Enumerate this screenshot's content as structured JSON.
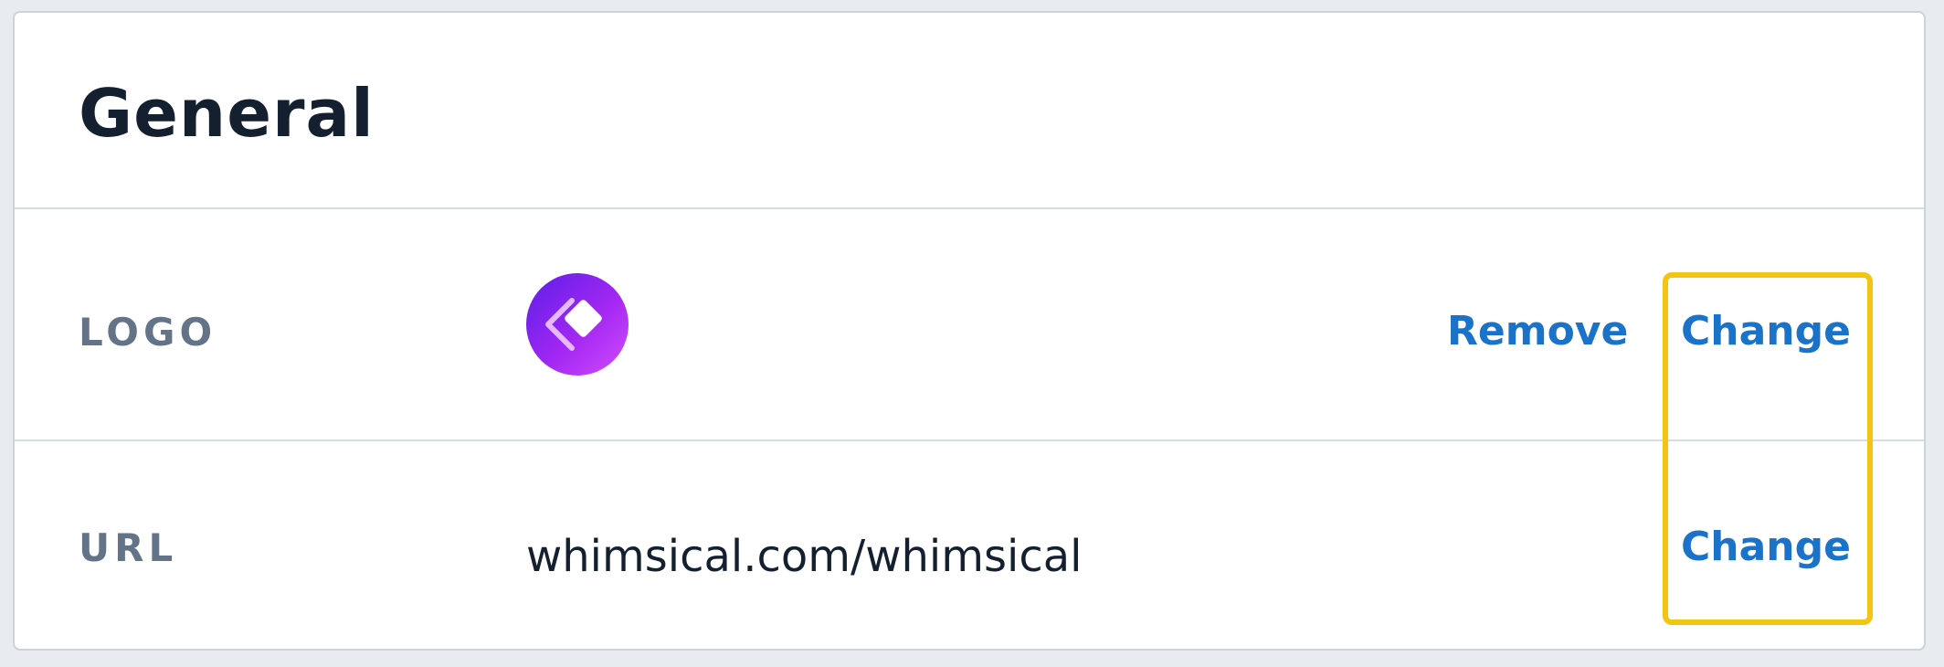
{
  "section": {
    "title": "General"
  },
  "logo_row": {
    "label": "LOGO",
    "logo_icon": "whimsical-logo-icon",
    "remove_label": "Remove",
    "change_label": "Change"
  },
  "url_row": {
    "label": "URL",
    "value": "whimsical.com/whimsical",
    "change_label": "Change"
  },
  "colors": {
    "accent": "#1a73c8",
    "highlight": "#f2c513",
    "logo_gradient_start": "#5b1ee8",
    "logo_gradient_end": "#d44cff"
  }
}
